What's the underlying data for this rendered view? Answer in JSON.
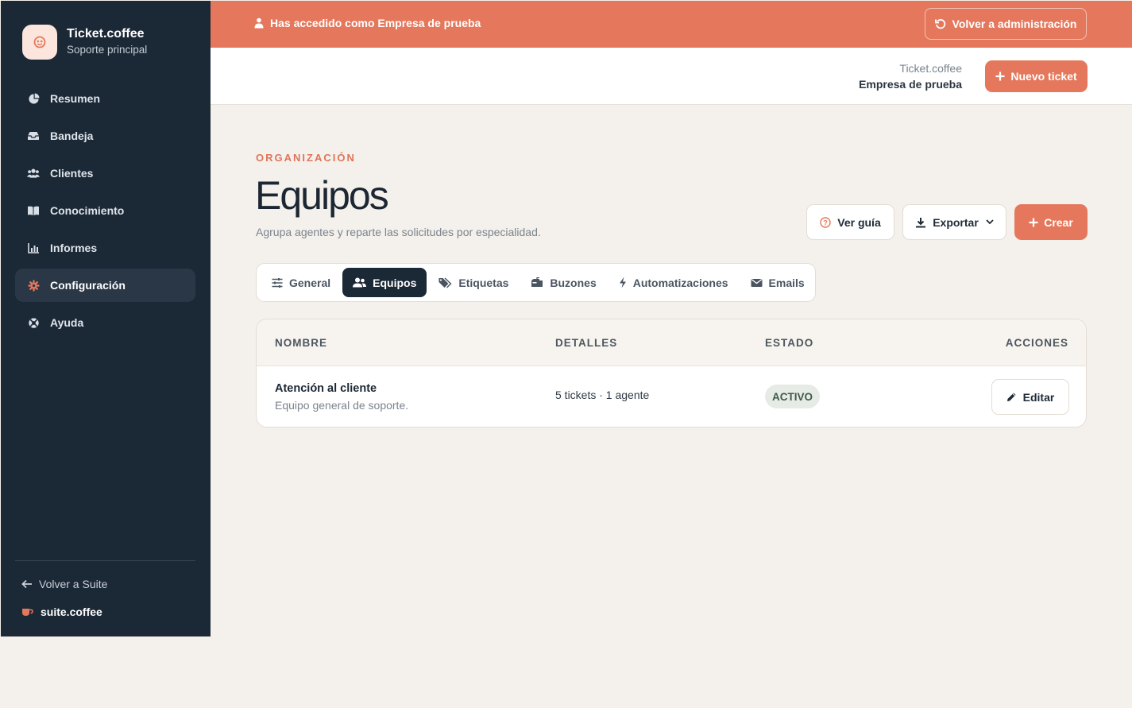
{
  "sidebar": {
    "brand_name": "Ticket.coffee",
    "brand_sub": "Soporte principal",
    "items": [
      {
        "label": "Resumen",
        "icon": "pie-chart-icon"
      },
      {
        "label": "Bandeja",
        "icon": "inbox-icon"
      },
      {
        "label": "Clientes",
        "icon": "users-icon"
      },
      {
        "label": "Conocimiento",
        "icon": "book-icon"
      },
      {
        "label": "Informes",
        "icon": "bar-chart-icon"
      },
      {
        "label": "Configuración",
        "icon": "gear-icon",
        "active": true
      },
      {
        "label": "Ayuda",
        "icon": "life-ring-icon"
      }
    ],
    "back_label": "Volver a Suite",
    "suite_label": "suite.coffee"
  },
  "banner": {
    "text": "Has accedido como Empresa de prueba",
    "button_label": "Volver a administración"
  },
  "topbar": {
    "app_name": "Ticket.coffee",
    "org_name": "Empresa de prueba",
    "new_ticket_label": "Nuevo ticket"
  },
  "page": {
    "eyebrow": "ORGANIZACIÓN",
    "title": "Equipos",
    "subtitle": "Agrupa agentes y reparte las solicitudes por especialidad.",
    "guide_label": "Ver guía",
    "export_label": "Exportar",
    "create_label": "Crear"
  },
  "tabs": [
    {
      "label": "General",
      "icon": "sliders-icon"
    },
    {
      "label": "Equipos",
      "icon": "users-icon",
      "active": true
    },
    {
      "label": "Etiquetas",
      "icon": "tags-icon"
    },
    {
      "label": "Buzones",
      "icon": "mailbox-icon"
    },
    {
      "label": "Automatizaciones",
      "icon": "bolt-icon"
    },
    {
      "label": "Emails",
      "icon": "envelope-icon"
    }
  ],
  "table": {
    "headers": [
      "NOMBRE",
      "DETALLES",
      "ESTADO",
      "ACCIONES"
    ],
    "rows": [
      {
        "name": "Atención al cliente",
        "description": "Equipo general de soporte.",
        "details": "5 tickets · 1 agente",
        "status": "ACTIVO",
        "action_label": "Editar"
      }
    ]
  },
  "colors": {
    "accent": "#e5785c",
    "sidebar_bg": "#1b2836",
    "page_bg": "#f4f1ec"
  }
}
